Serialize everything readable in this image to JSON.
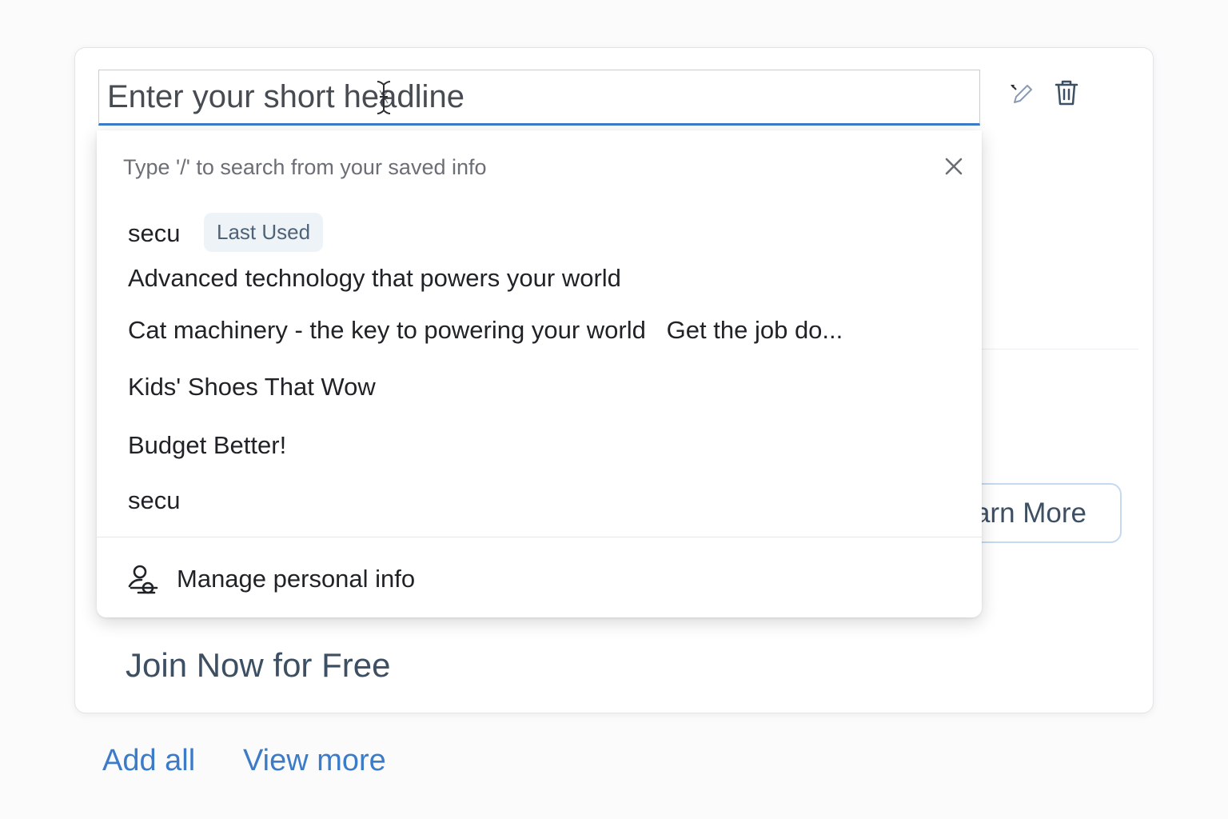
{
  "headline_field": {
    "placeholder": "Enter your short headline"
  },
  "card": {
    "learn_more_label": "Learn More",
    "join_now_text": "Join Now for Free"
  },
  "footer_links": {
    "add_all": "Add all",
    "view_more": "View more"
  },
  "autofill_dropdown": {
    "hint": "Type '/' to search from your saved info",
    "badge": "Last Used",
    "suggestions": [
      "secu",
      "Advanced technology that powers your world",
      "Cat machinery - the key to powering your world   Get the job do...",
      "Kids' Shoes That Wow",
      "Budget Better!",
      "secu"
    ],
    "manage_label": "Manage personal info"
  },
  "colors": {
    "accent": "#3b7bc8",
    "badge_bg": "#eef3f8",
    "text_dark": "#1f2226",
    "button_text": "#3d4f63"
  },
  "icons": {
    "edit": "pencil-icon",
    "delete": "trash-icon",
    "close": "close-icon",
    "manage": "manage-info-icon",
    "cursor": "text-cursor-icon"
  }
}
